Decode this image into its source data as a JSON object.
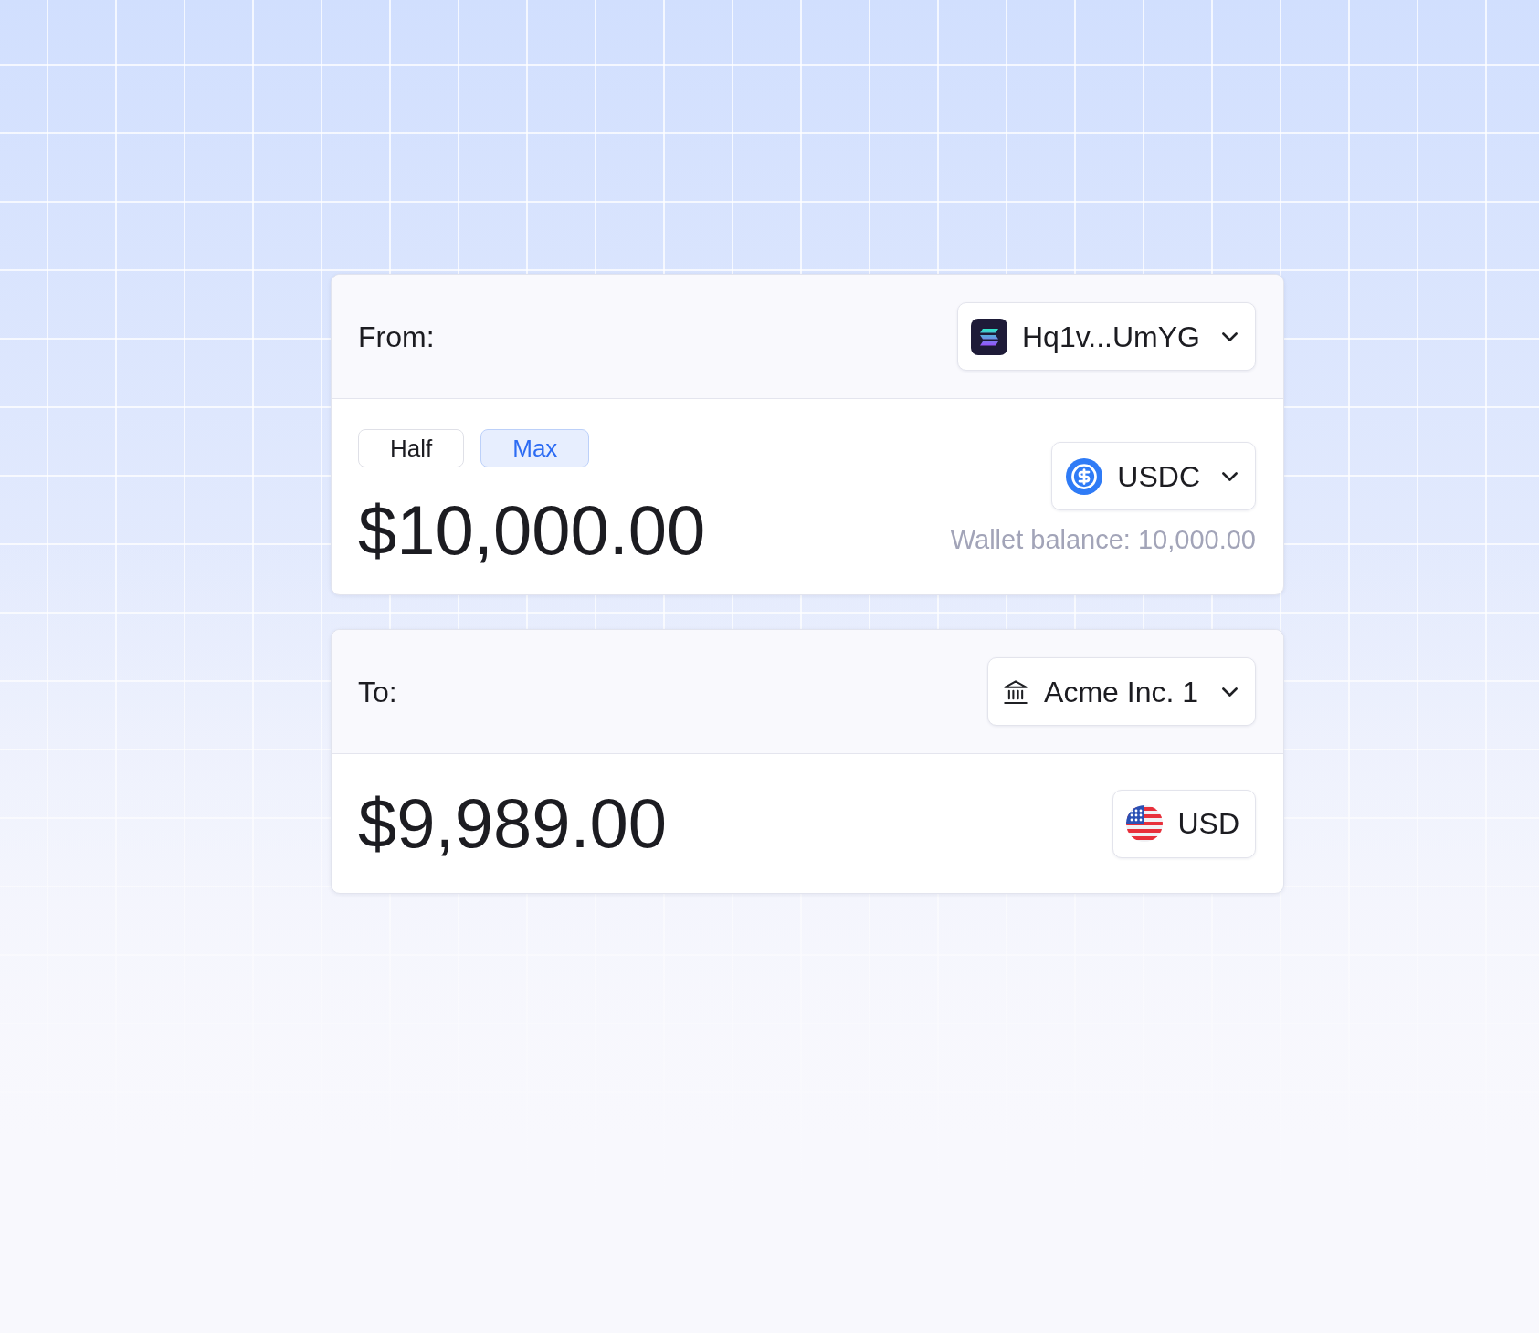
{
  "cards": [
    {
      "header": {
        "label": "From:",
        "selector": {
          "kind": "wallet",
          "text": "Hq1v...UmYG",
          "dropdown": true
        }
      },
      "quick_amounts": [
        {
          "label": "Half",
          "selected": false
        },
        {
          "label": "Max",
          "selected": true
        }
      ],
      "amount": "$10,000.00",
      "currency": {
        "kind": "token",
        "text": "USDC",
        "dropdown": true
      },
      "balance": "Wallet balance: 10,000.00"
    },
    {
      "header": {
        "label": "To:",
        "selector": {
          "kind": "bank",
          "text": "Acme Inc. 1",
          "dropdown": true
        }
      },
      "amount": "$9,989.00",
      "currency": {
        "kind": "flag",
        "text": "USD",
        "dropdown": false
      }
    }
  ]
}
